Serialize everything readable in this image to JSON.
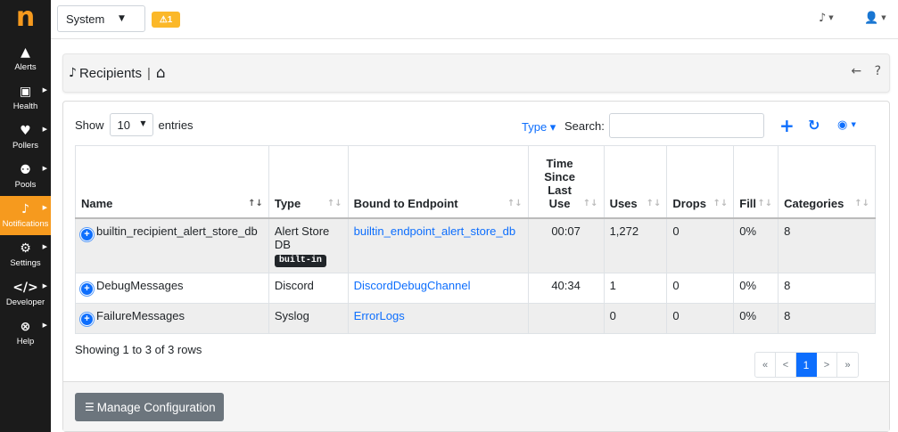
{
  "sidebar": {
    "logo": "n",
    "items": [
      {
        "label": "Alerts",
        "icon": "alert-triangle-icon",
        "glyph": "▲",
        "submenu": false
      },
      {
        "label": "Health",
        "icon": "monitor-icon",
        "glyph": "▣",
        "submenu": true
      },
      {
        "label": "Pollers",
        "icon": "heartbeat-icon",
        "glyph": "♥",
        "submenu": true
      },
      {
        "label": "Pools",
        "icon": "users-icon",
        "glyph": "⚉",
        "submenu": true
      },
      {
        "label": "Notifications",
        "icon": "bell-icon",
        "glyph": "🔔",
        "submenu": true,
        "active": true
      },
      {
        "label": "Settings",
        "icon": "gear-icon",
        "glyph": "⚙",
        "submenu": true
      },
      {
        "label": "Developer",
        "icon": "code-icon",
        "glyph": "</>",
        "submenu": true
      },
      {
        "label": "Help",
        "icon": "lifebuoy-icon",
        "glyph": "⊗",
        "submenu": true
      }
    ]
  },
  "topbar": {
    "system_select": "System",
    "alarm_badge": "⚠1"
  },
  "breadcrumb": {
    "title": "Recipients",
    "separator": "|"
  },
  "toolbar": {
    "show_label": "Show",
    "entries_value": "10",
    "entries_label": "entries",
    "type_filter": "Type ▾",
    "search_label": "Search:",
    "search_value": ""
  },
  "table": {
    "columns": [
      "Name",
      "Type",
      "Bound to Endpoint",
      "Time Since Last Use",
      "Uses",
      "Drops",
      "Fill",
      "Categories"
    ],
    "rows": [
      {
        "name": "builtin_recipient_alert_store_db",
        "type": "Alert Store DB",
        "badge": "built-in",
        "endpoint": "builtin_endpoint_alert_store_db",
        "time": "00:07",
        "uses": "1,272",
        "drops": "0",
        "fill": "0%",
        "categories": "8"
      },
      {
        "name": "DebugMessages",
        "type": "Discord",
        "badge": "",
        "endpoint": "DiscordDebugChannel",
        "time": "40:34",
        "uses": "1",
        "drops": "0",
        "fill": "0%",
        "categories": "8"
      },
      {
        "name": "FailureMessages",
        "type": "Syslog",
        "badge": "",
        "endpoint": "ErrorLogs",
        "time": "",
        "uses": "0",
        "drops": "0",
        "fill": "0%",
        "categories": "8"
      }
    ]
  },
  "footer_info": "Showing 1 to 3 of 3 rows",
  "pagination": {
    "first": "«",
    "prev": "<",
    "current": "1",
    "next": ">",
    "last": "»"
  },
  "manage_button": "Manage Configuration",
  "colors": {
    "accent": "#f69a1e",
    "link": "#0d6efd",
    "sidebar_bg": "#1b1b1b",
    "badge_warning": "#fbb829"
  }
}
